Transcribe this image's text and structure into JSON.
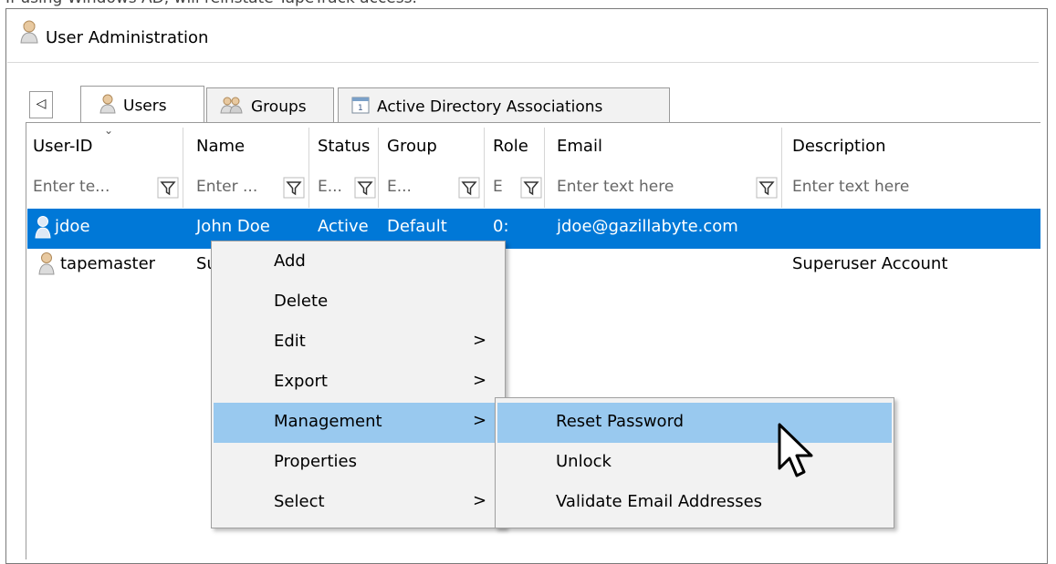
{
  "caption": "If using Windows AD, will reinstate TapeTrack access.",
  "window": {
    "title": "User Administration"
  },
  "tabs": [
    {
      "label": "Users",
      "active": true,
      "icon": "user-icon"
    },
    {
      "label": "Groups",
      "active": false,
      "icon": "group-icon"
    },
    {
      "label": "Active Directory Associations",
      "active": false,
      "icon": "calendar-icon"
    }
  ],
  "tab_scroll_glyph": "◁",
  "columns": [
    {
      "label": "User-ID",
      "filter_placeholder": "Enter te..."
    },
    {
      "label": "Name",
      "filter_placeholder": "Enter ..."
    },
    {
      "label": "Status",
      "filter_placeholder": "E..."
    },
    {
      "label": "Group",
      "filter_placeholder": "E..."
    },
    {
      "label": "Role",
      "filter_placeholder": "E"
    },
    {
      "label": "Email",
      "filter_placeholder": "Enter text here"
    },
    {
      "label": "Description",
      "filter_placeholder": "Enter text here"
    }
  ],
  "rows": [
    {
      "user_id": "jdoe",
      "name": "John Doe",
      "status": "Active",
      "group": "Default",
      "role": "0:",
      "email": "jdoe@gazillabyte.com",
      "description": "",
      "selected": true
    },
    {
      "user_id": "tapemaster",
      "name": "Su",
      "status": "",
      "group": "",
      "role": "",
      "email": "",
      "description": "Superuser Account",
      "selected": false
    }
  ],
  "context_menu": {
    "items": [
      {
        "label": "Add",
        "submenu": false
      },
      {
        "label": "Delete",
        "submenu": false
      },
      {
        "label": "Edit",
        "submenu": true
      },
      {
        "label": "Export",
        "submenu": true
      },
      {
        "label": "Management",
        "submenu": true,
        "highlighted": true
      },
      {
        "label": "Properties",
        "submenu": false
      },
      {
        "label": "Select",
        "submenu": true
      }
    ],
    "submenu_arrow": ">"
  },
  "management_submenu": {
    "items": [
      {
        "label": "Reset Password",
        "highlighted": true
      },
      {
        "label": "Unlock"
      },
      {
        "label": "Validate Email Addresses"
      }
    ]
  },
  "colors": {
    "selection": "#0078d7",
    "menu_highlight": "#99c9ef",
    "menu_bg": "#f2f2f2"
  }
}
